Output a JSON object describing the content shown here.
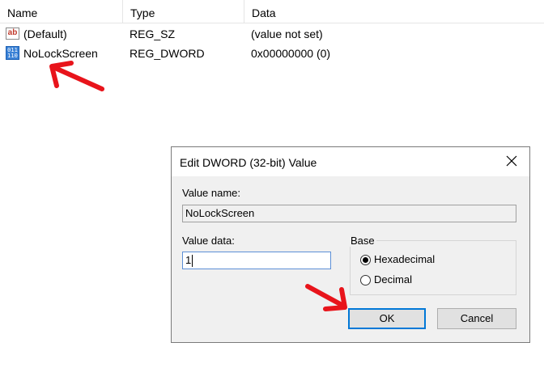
{
  "list": {
    "columns": [
      "Name",
      "Type",
      "Data"
    ],
    "rows": [
      {
        "name": "(Default)",
        "type": "REG_SZ",
        "data": "(value not set)",
        "icon": "string-value-icon"
      },
      {
        "name": "NoLockScreen",
        "type": "REG_DWORD",
        "data": "0x00000000 (0)",
        "icon": "dword-value-icon"
      }
    ]
  },
  "dialog": {
    "title": "Edit DWORD (32-bit) Value",
    "value_name_label": "Value name:",
    "value_name": "NoLockScreen",
    "value_data_label": "Value data:",
    "value_data": "1",
    "base_label": "Base",
    "base_options": [
      "Hexadecimal",
      "Decimal"
    ],
    "base_selected": "Hexadecimal",
    "ok_label": "OK",
    "cancel_label": "Cancel"
  },
  "icons": {
    "string": "ab",
    "dword": "011 110"
  },
  "colors": {
    "annotation_arrow": "#e8141b",
    "default_button_border": "#0078d7"
  }
}
